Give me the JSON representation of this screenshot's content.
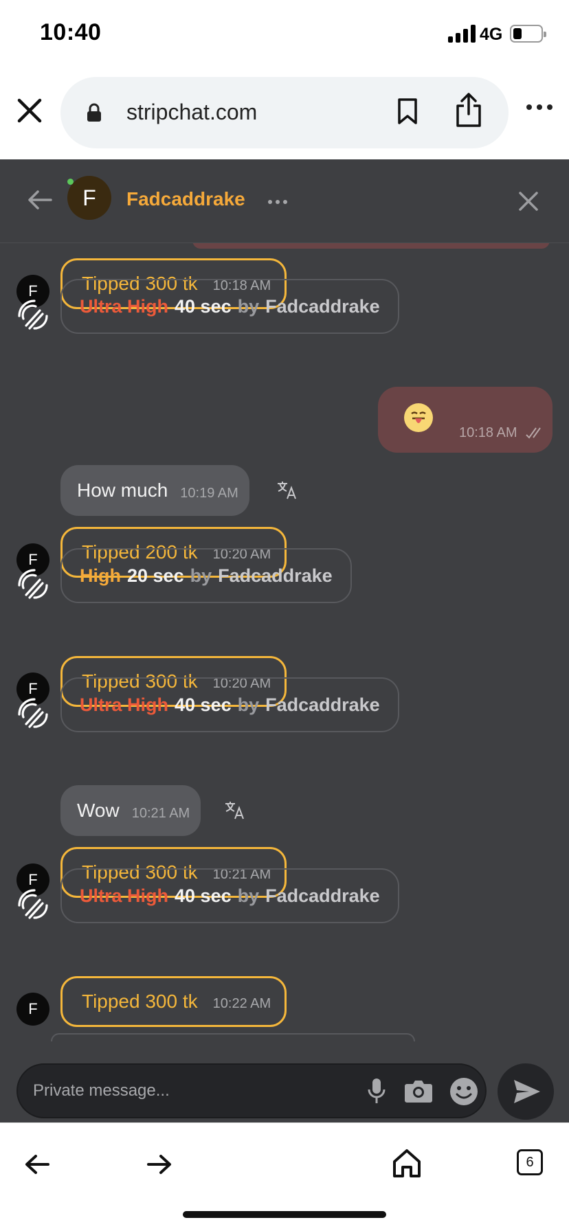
{
  "status_bar": {
    "time": "10:40",
    "network": "4G"
  },
  "browser": {
    "url": "stripchat.com",
    "tabs_count": "6"
  },
  "chat": {
    "contact_name": "Fadcaddrake",
    "contact_initial": "F",
    "composer_placeholder": "Private message...",
    "messages": [
      {
        "type": "tip",
        "initial": "F",
        "text": "Tipped 300 tk",
        "time": "10:18 AM"
      },
      {
        "type": "vibration",
        "level": "Ultra High",
        "duration": "40 sec",
        "by": "by",
        "user": "Fadcaddrake"
      },
      {
        "type": "outgoing",
        "time": "10:18 AM"
      },
      {
        "type": "incoming",
        "text": "How much",
        "time": "10:19 AM"
      },
      {
        "type": "tip",
        "initial": "F",
        "text": "Tipped 200 tk",
        "time": "10:20 AM"
      },
      {
        "type": "vibration",
        "level": "High",
        "duration": "20 sec",
        "by": "by",
        "user": "Fadcaddrake"
      },
      {
        "type": "tip",
        "initial": "F",
        "text": "Tipped 300 tk",
        "time": "10:20 AM"
      },
      {
        "type": "vibration",
        "level": "Ultra High",
        "duration": "40 sec",
        "by": "by",
        "user": "Fadcaddrake"
      },
      {
        "type": "incoming",
        "text": "Wow",
        "time": "10:21 AM"
      },
      {
        "type": "tip",
        "initial": "F",
        "text": "Tipped 300 tk",
        "time": "10:21 AM"
      },
      {
        "type": "vibration",
        "level": "Ultra High",
        "duration": "40 sec",
        "by": "by",
        "user": "Fadcaddrake"
      },
      {
        "type": "tip",
        "initial": "F",
        "text": "Tipped 300 tk",
        "time": "10:22 AM"
      }
    ]
  },
  "colors": {
    "accent_orange": "#f5a93a",
    "ultra_high_red": "#ec5a3a",
    "tip_border": "#f5b73b",
    "chat_bg": "#3e3f42",
    "outgoing_bubble": "#6a4446"
  }
}
